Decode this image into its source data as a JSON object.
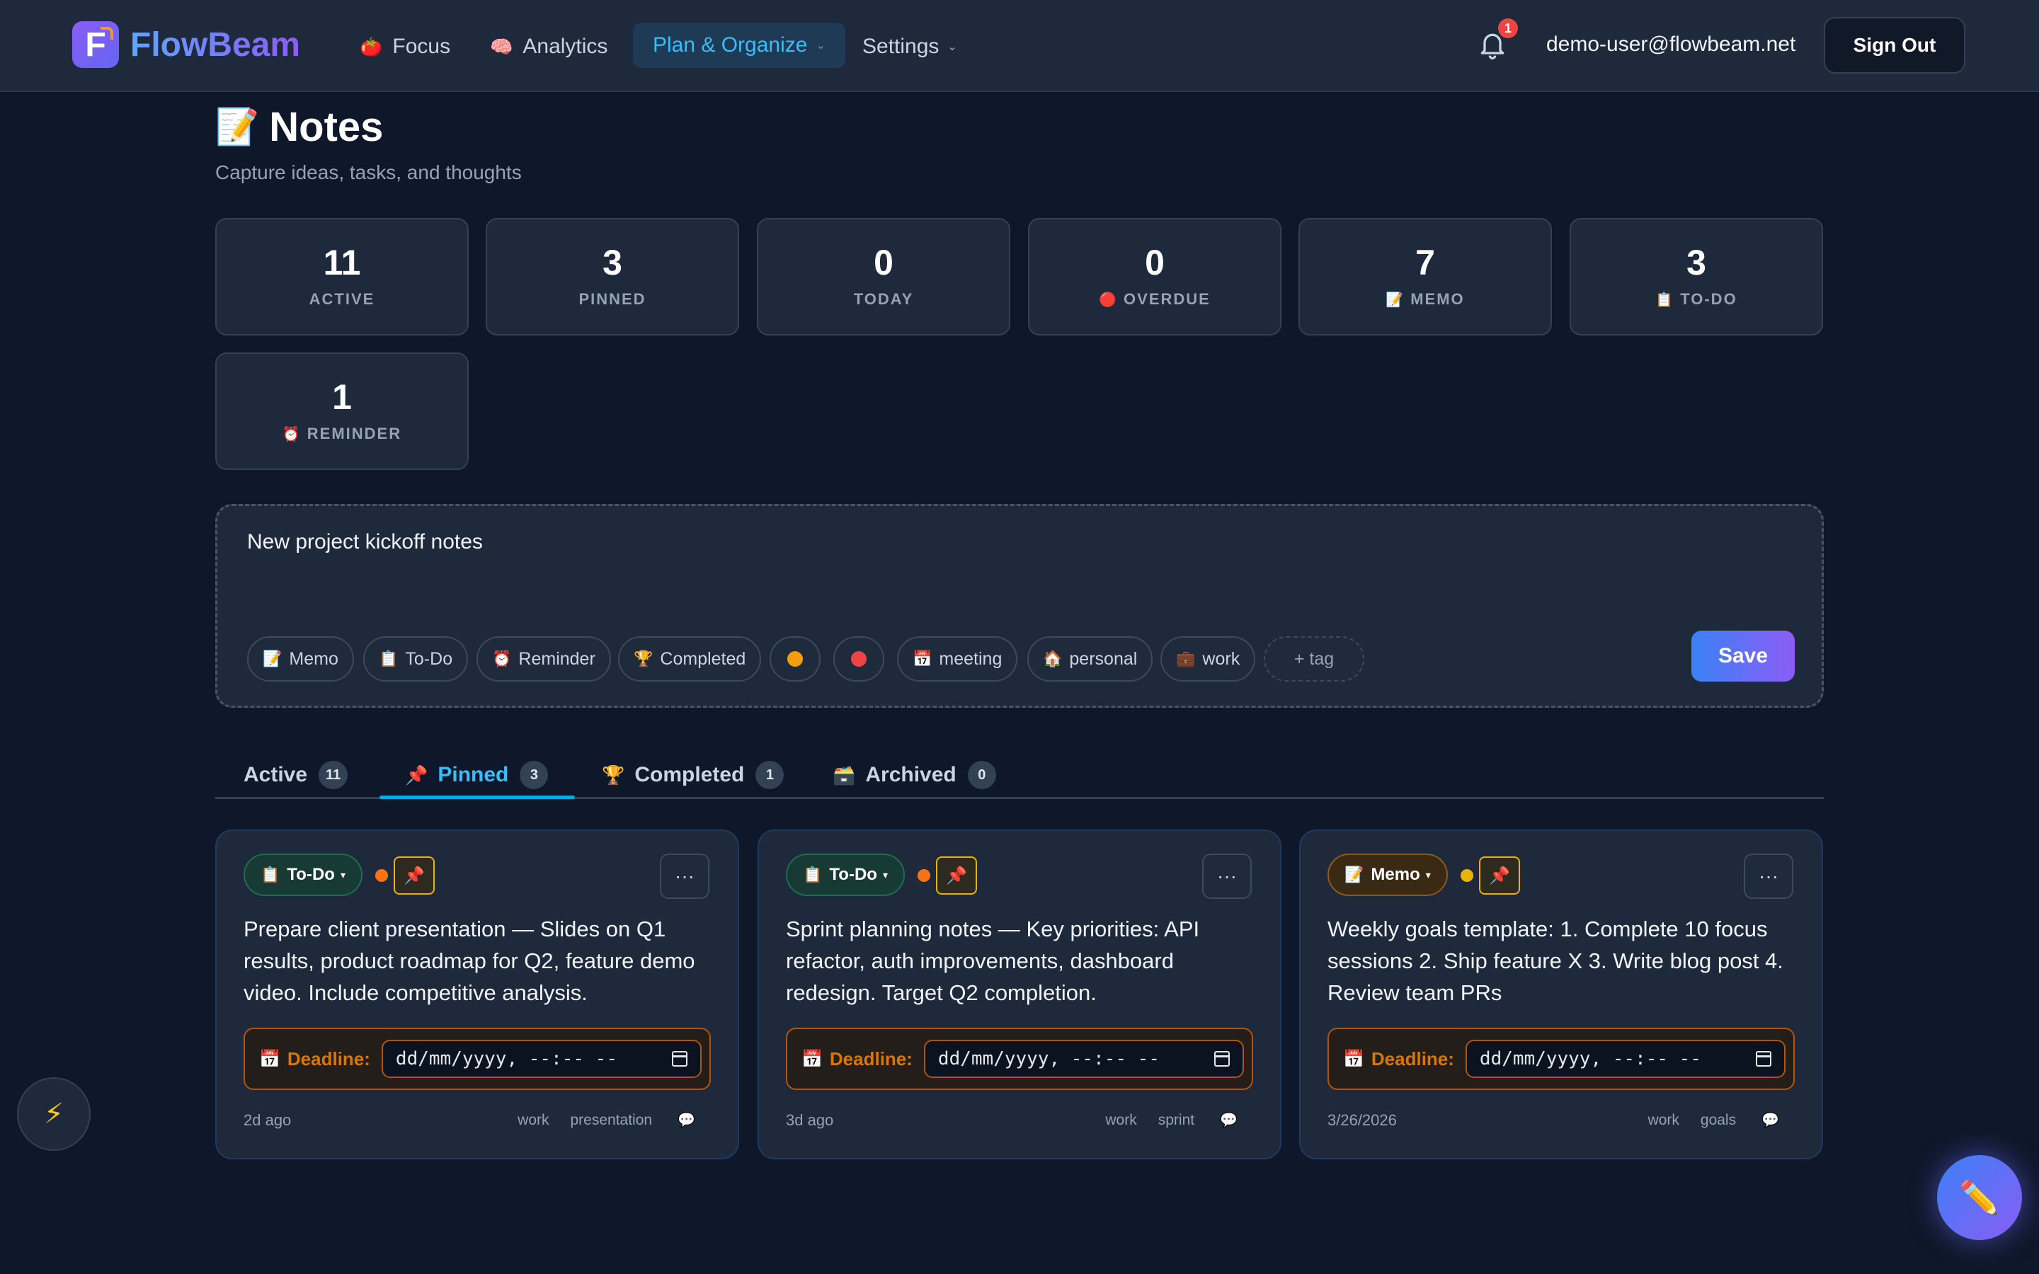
{
  "nav": {
    "logo_letter": "F",
    "brand": "FlowBeam",
    "items": [
      {
        "label": "Focus",
        "icon": "tomato-icon",
        "emoji": "🍅"
      },
      {
        "label": "Analytics",
        "icon": "brain-icon",
        "emoji": "🧠"
      },
      {
        "label": "Plan & Organize",
        "active": true
      },
      {
        "label": "Settings"
      }
    ],
    "notification_count": "1",
    "user_email": "demo-user@flowbeam.net",
    "signout_label": "Sign Out"
  },
  "header": {
    "emoji": "📝",
    "title": "Notes",
    "subtitle": "Capture ideas, tasks, and thoughts"
  },
  "stats": [
    {
      "value": "11",
      "label": "ACTIVE",
      "emoji": ""
    },
    {
      "value": "3",
      "label": "PINNED",
      "emoji": ""
    },
    {
      "value": "0",
      "label": "TODAY",
      "emoji": ""
    },
    {
      "value": "0",
      "label": "OVERDUE",
      "emoji": "🔴"
    },
    {
      "value": "7",
      "label": "MEMO",
      "emoji": "📝"
    },
    {
      "value": "3",
      "label": "TO-DO",
      "emoji": "📋"
    },
    {
      "value": "1",
      "label": "REMINDER",
      "emoji": "⏰"
    }
  ],
  "composer": {
    "value": "New project kickoff notes",
    "chips": [
      {
        "label": "Memo",
        "emoji": "📝"
      },
      {
        "label": "To-Do",
        "emoji": "📋"
      },
      {
        "label": "Reminder",
        "emoji": "⏰"
      },
      {
        "label": "Completed",
        "emoji": "🏆"
      },
      {
        "label": "meeting",
        "emoji": "📅"
      },
      {
        "label": "personal",
        "emoji": "🏠"
      },
      {
        "label": "work",
        "emoji": "💼"
      }
    ],
    "priority_colors": [
      "#f59e0b",
      "#ef4444"
    ],
    "add_tag_label": "+ tag",
    "save_label": "Save"
  },
  "tabs": [
    {
      "label": "Active",
      "count": "11",
      "emoji": ""
    },
    {
      "label": "Pinned",
      "count": "3",
      "emoji": "📌",
      "active": true
    },
    {
      "label": "Completed",
      "count": "1",
      "emoji": "🏆"
    },
    {
      "label": "Archived",
      "count": "0",
      "emoji": "🗃️"
    }
  ],
  "cards": [
    {
      "type": "To-Do",
      "type_emoji": "📋",
      "priority_color": "#f97316",
      "text": "Prepare client presentation — Slides on Q1 results, product roadmap for Q2, feature demo video. Include competitive analysis.",
      "deadline_label": "Deadline:",
      "deadline_placeholder": "dd/mm/yyyy, --:-- --",
      "time": "2d ago",
      "tags": [
        "work",
        "presentation"
      ]
    },
    {
      "type": "To-Do",
      "type_emoji": "📋",
      "priority_color": "#f97316",
      "text": "Sprint planning notes — Key priorities: API refactor, auth improvements, dashboard redesign. Target Q2 completion.",
      "deadline_label": "Deadline:",
      "deadline_placeholder": "dd/mm/yyyy, --:-- --",
      "time": "3d ago",
      "tags": [
        "work",
        "sprint"
      ]
    },
    {
      "type": "Memo",
      "type_emoji": "📝",
      "priority_color": "#eab308",
      "text": "Weekly goals template: 1. Complete 10 focus sessions 2. Ship feature X 3. Write blog post 4. Review team PRs",
      "deadline_label": "Deadline:",
      "deadline_placeholder": "dd/mm/yyyy, --:-- --",
      "time": "3/26/2026",
      "tags": [
        "work",
        "goals"
      ]
    }
  ],
  "floating": {
    "left_icon": "⚡",
    "right_icon": "✏️"
  },
  "common": {
    "pin_emoji": "📌",
    "more_label": "···",
    "caret": "▾",
    "comment_emoji": "💬",
    "calendar_emoji": "📅",
    "chevron": "⌄"
  }
}
